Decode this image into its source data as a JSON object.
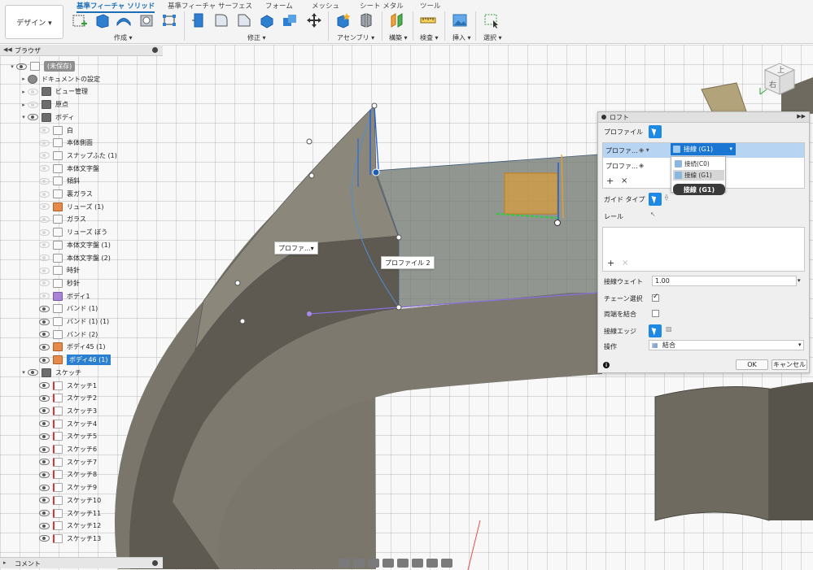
{
  "toolbar": {
    "design_button": "デザイン ▾",
    "tabs": [
      "基準フィーチャ ソリッド",
      "基準フィーチャ サーフェス",
      "フォーム",
      "メッシュ",
      "シート メタル",
      "ツール"
    ],
    "groups": [
      "作成 ▾",
      "修正 ▾",
      "アセンブリ ▾",
      "構築 ▾",
      "検査 ▾",
      "挿入 ▾",
      "選択 ▾"
    ]
  },
  "browser": {
    "title": "ブラウザ",
    "items": [
      {
        "label": "(未保存)",
        "icon": "document-icon"
      },
      {
        "label": "ドキュメントの設定",
        "icon": "gear-icon"
      },
      {
        "label": "ビュー管理",
        "icon": "folder-icon"
      },
      {
        "label": "原点",
        "icon": "folder-icon"
      },
      {
        "label": "ボディ",
        "icon": "folder-icon"
      },
      {
        "label": "白",
        "icon": "body-icon"
      },
      {
        "label": "本体側面",
        "icon": "body-icon"
      },
      {
        "label": "スナップふた (1)",
        "icon": "body-icon"
      },
      {
        "label": "本体文字盤",
        "icon": "body-icon"
      },
      {
        "label": "傾斜",
        "icon": "body-icon"
      },
      {
        "label": "裏ガラス",
        "icon": "body-icon"
      },
      {
        "label": "リューズ (1)",
        "icon": "body-icon"
      },
      {
        "label": "ガラス",
        "icon": "body-icon"
      },
      {
        "label": "リューズ ぼう",
        "icon": "body-icon"
      },
      {
        "label": "本体文字盤 (1)",
        "icon": "body-icon"
      },
      {
        "label": "本体文字盤 (2)",
        "icon": "body-icon"
      },
      {
        "label": "時針",
        "icon": "body-icon"
      },
      {
        "label": "秒針",
        "icon": "body-icon"
      },
      {
        "label": "ボディ1",
        "icon": "body-icon"
      },
      {
        "label": "バンド (1)",
        "icon": "body-icon"
      },
      {
        "label": "バンド (1) (1)",
        "icon": "body-icon"
      },
      {
        "label": "バンド (2)",
        "icon": "body-icon"
      },
      {
        "label": "ボディ45 (1)",
        "icon": "body-icon"
      },
      {
        "label": "ボディ46 (1)",
        "icon": "body-icon"
      },
      {
        "label": "スケッチ",
        "icon": "folder-icon"
      },
      {
        "label": "スケッチ1",
        "icon": "sketch-icon"
      },
      {
        "label": "スケッチ2",
        "icon": "sketch-icon"
      },
      {
        "label": "スケッチ3",
        "icon": "sketch-icon"
      },
      {
        "label": "スケッチ4",
        "icon": "sketch-icon"
      },
      {
        "label": "スケッチ5",
        "icon": "sketch-icon"
      },
      {
        "label": "スケッチ6",
        "icon": "sketch-icon"
      },
      {
        "label": "スケッチ7",
        "icon": "sketch-icon"
      },
      {
        "label": "スケッチ8",
        "icon": "sketch-icon"
      },
      {
        "label": "スケッチ9",
        "icon": "sketch-icon"
      },
      {
        "label": "スケッチ10",
        "icon": "sketch-icon"
      },
      {
        "label": "スケッチ11",
        "icon": "sketch-icon"
      },
      {
        "label": "スケッチ12",
        "icon": "sketch-icon"
      },
      {
        "label": "スケッチ13",
        "icon": "sketch-icon"
      }
    ]
  },
  "comment_bar": {
    "title": "コメント"
  },
  "viewport": {
    "label_profile_dropdown": "プロファ...▾",
    "label_profile2": "プロファイル 2",
    "viewcube_top": "上",
    "viewcube_front": "右"
  },
  "loft": {
    "title": "ロフト",
    "profile_label": "プロファイル",
    "rows": [
      {
        "label": "プロファ..."
      },
      {
        "label": "プロファ..."
      }
    ],
    "dropdown_value": "接線 (G1)",
    "dropdown_options": [
      "接続(C0)",
      "接線 (G1)"
    ],
    "dropdown_tooltip": "接線 (G1)",
    "add": "+",
    "remove": "×",
    "guide_type_label": "ガイド タイプ",
    "rail_label": "レール",
    "tangent_weight_label": "接線ウェイト",
    "tangent_weight_value": "1.00",
    "chain_label": "チェーン選択",
    "chain_checked": true,
    "merge_ends_label": "両端を結合",
    "merge_ends_checked": false,
    "tangent_edges_label": "接線エッジ",
    "operation_label": "操作",
    "operation_value": "結合",
    "ok": "OK",
    "cancel": "キャンセル"
  },
  "colors": {
    "accent": "#1976d2",
    "selection": "#2b7fd0",
    "model": "#6e6a60"
  }
}
